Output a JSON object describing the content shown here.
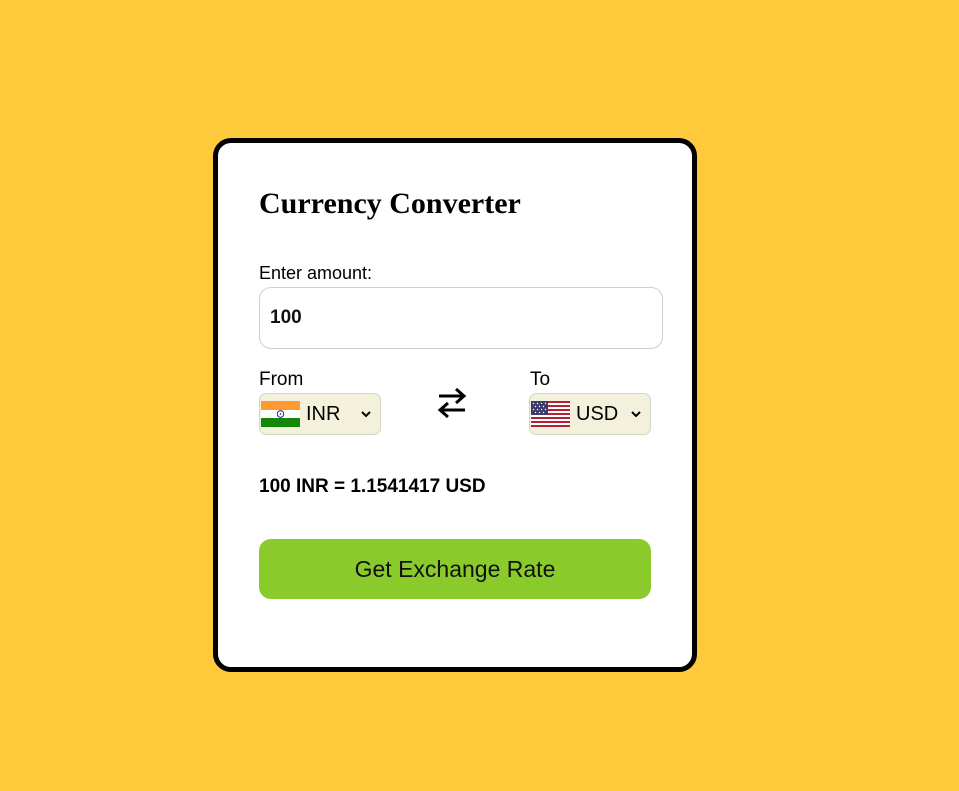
{
  "converter": {
    "title": "Currency Converter",
    "amount_label": "Enter amount:",
    "amount_value": "100",
    "from_label": "From",
    "to_label": "To",
    "from_currency": "INR",
    "to_currency": "USD",
    "result": "100 INR = 1.1541417 USD",
    "button_label": "Get Exchange Rate"
  },
  "icons": {
    "from_flag": "india-flag-icon",
    "to_flag": "usa-flag-icon",
    "swap": "swap-arrows-icon",
    "dropdown": "chevron-down-icon"
  },
  "colors": {
    "background": "#FFC93C",
    "card": "#FFFFFF",
    "card_border": "#000000",
    "button": "#8ACA2A",
    "select_background": "#F3F1DC"
  }
}
